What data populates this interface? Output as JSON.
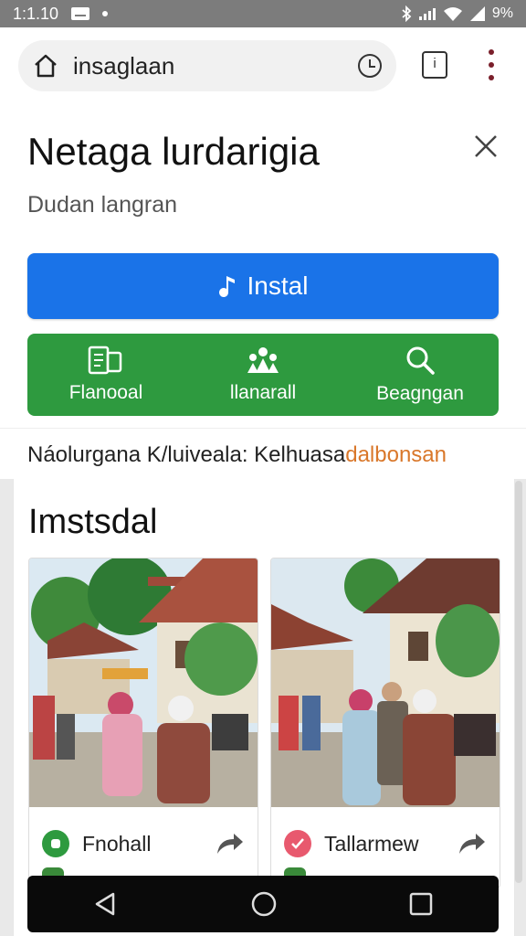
{
  "status_bar": {
    "time": "1:1.10",
    "battery": "9%"
  },
  "browser": {
    "url": "insaglaan",
    "icons": [
      "home-icon",
      "clock-icon",
      "tab-icon",
      "menu-icon"
    ]
  },
  "app": {
    "title": "Netaga lurdarigia",
    "subtitle": "Dudan langran",
    "install_label": "Instal",
    "actions": [
      {
        "label": "Flanooal",
        "icon": "document-icon"
      },
      {
        "label": "llanarall",
        "icon": "people-icon"
      },
      {
        "label": "Beagngan",
        "icon": "search-icon"
      }
    ],
    "info_text": "Náolurgana K/luiveala: Kelhuasa",
    "info_highlight": "dalbonsan",
    "colors": {
      "install": "#1a73e8",
      "actions": "#2e9a3f",
      "highlight": "#d9772a"
    }
  },
  "gallery": {
    "title": "Imstsdal",
    "cards": [
      {
        "label": "Fnohall",
        "badge_color": "#2e9a3f"
      },
      {
        "label": "Tallarmew",
        "badge_color": "#e8596e"
      }
    ]
  },
  "navbar": {
    "icons": [
      "back-icon",
      "home-circle-icon",
      "recents-icon"
    ]
  }
}
